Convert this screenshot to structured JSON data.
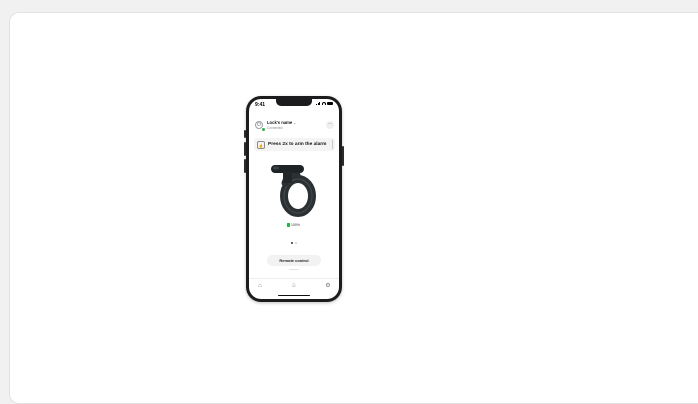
{
  "phone": {
    "status_bar": {
      "time": "9:41"
    },
    "header": {
      "lock_name": "Lock's name",
      "status": "Connected"
    },
    "banner": {
      "text": "Press 2x to arm the alarm"
    },
    "battery": {
      "percent": "100%"
    },
    "pager": {
      "count": 2,
      "active_index": 0
    },
    "remote_button": {
      "label": "Remote control"
    },
    "tabbar": {
      "items": [
        "home-icon",
        "bell-icon",
        "settings-icon"
      ]
    }
  },
  "colors": {
    "accent_green": "#2bb24c",
    "phone_frame": "#1c1c1e"
  }
}
